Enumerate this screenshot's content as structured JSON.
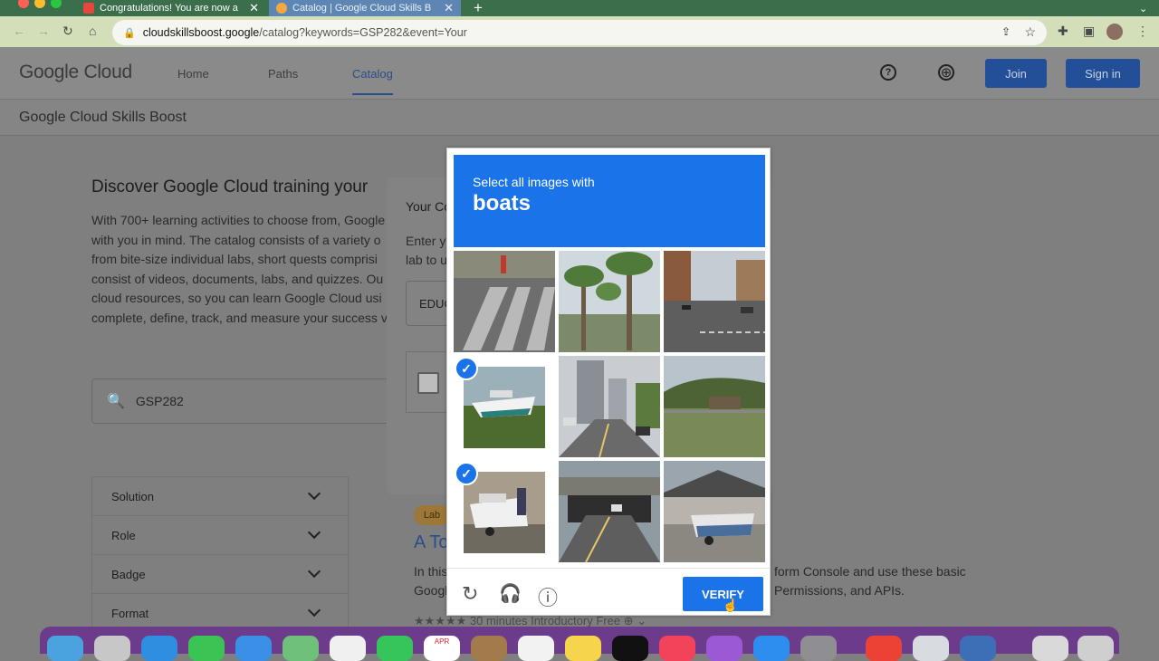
{
  "browser": {
    "tabs": [
      {
        "title": "Congratulations! You are now a",
        "close": "✕"
      },
      {
        "title": "Catalog | Google Cloud Skills B",
        "close": "✕"
      }
    ],
    "new_tab": "+",
    "url_domain": "cloudskillsboost.google",
    "url_path": "/catalog?keywords=GSP282&event=Your"
  },
  "header": {
    "logo_google": "Google",
    "logo_cloud": " Cloud",
    "nav": [
      "Home",
      "Paths",
      "Catalog"
    ],
    "join": "Join",
    "signin": "Sign in",
    "help_glyph": "?",
    "globe_glyph": "⊕"
  },
  "subbar": {
    "title": "Google Cloud Skills Boost"
  },
  "main": {
    "heading": "Discover Google Cloud training your",
    "lines": [
      "With 700+ learning activities to choose from, Google",
      "with you in mind. The catalog consists of a variety o",
      "from bite-size individual labs, short quests comprisi",
      "consist of videos, documents, labs, and quizzes. Ou",
      "cloud resources, so you can learn Google Cloud usi",
      "complete, define, track, and measure your success v"
    ],
    "search_value": "GSP282",
    "filters": [
      "Solution",
      "Role",
      "Badge",
      "Format"
    ]
  },
  "card": {
    "title": "Your Co",
    "text1": "Enter yo",
    "text2": "lab to u",
    "input_value": "EDUC"
  },
  "lab": {
    "badge": "Lab",
    "title": "A To",
    "desc1_left": "In this",
    "desc2_left": "Googl",
    "desc1_right": "form Console and use these basic",
    "desc2_right": "Permissions, and APIs.",
    "meta": "★★★★★   30 minutes   Introductory   Free   ⊕  ⌄"
  },
  "captcha": {
    "instruction": "Select all images with",
    "target": "boats",
    "verify": "VERIFY",
    "check": "✓",
    "reload_glyph": "↻",
    "audio_glyph": "🎧",
    "info_glyph": "ⓘ",
    "tiles": [
      {
        "selected": false
      },
      {
        "selected": false
      },
      {
        "selected": false
      },
      {
        "selected": true
      },
      {
        "selected": false
      },
      {
        "selected": false
      },
      {
        "selected": true
      },
      {
        "selected": false
      },
      {
        "selected": false
      }
    ]
  },
  "dock": {
    "calendar_month": "APR"
  },
  "colors": {
    "accent": "#1a73e8",
    "header_button": "#234e98",
    "link": "#2a4e86"
  }
}
